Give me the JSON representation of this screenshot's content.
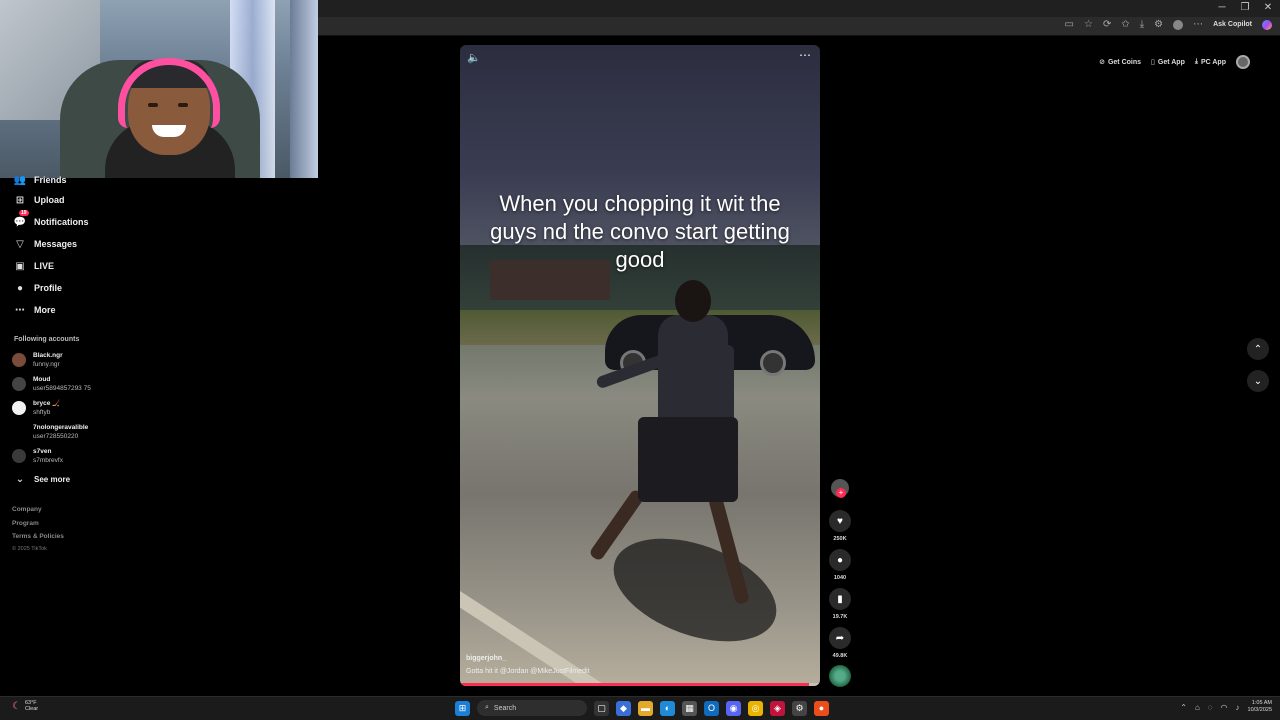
{
  "window": {
    "minimize": "─",
    "restore": "❐",
    "close": "✕"
  },
  "browser": {
    "copilot_label": "Ask Copilot",
    "icons": [
      "screen-icon",
      "star-icon",
      "extension-icon",
      "favorites-icon",
      "download-icon",
      "profile-icon",
      "menu-icon"
    ]
  },
  "sidebar": {
    "items": [
      {
        "label": "Friends",
        "icon": "friends-icon"
      },
      {
        "label": "Upload",
        "icon": "upload-icon"
      },
      {
        "label": "Notifications",
        "icon": "notifications-icon",
        "badge": "19"
      },
      {
        "label": "Messages",
        "icon": "messages-icon"
      },
      {
        "label": "LIVE",
        "icon": "live-icon"
      },
      {
        "label": "Profile",
        "icon": "profile-icon"
      },
      {
        "label": "More",
        "icon": "more-icon"
      }
    ],
    "following_title": "Following accounts",
    "accounts": [
      {
        "name": "Black.ngr",
        "handle": "funny.ngr"
      },
      {
        "name": "Moud",
        "handle": "user5894857293 75"
      },
      {
        "name": "bryce 🏒",
        "handle": "shftyb"
      },
      {
        "name": "7nolongeravalible",
        "handle": "user728550220"
      },
      {
        "name": "s7ven",
        "handle": "s7mbrevfx"
      }
    ],
    "see_more": "See more",
    "footer_links": [
      "Company",
      "Program",
      "Terms & Policies"
    ],
    "copyright": "© 2025 TikTok"
  },
  "video": {
    "caption": "When you chopping it wit the guys nd the convo start getting good",
    "author": "biggerjohn_",
    "description": "Gotta hit it @Jordan  @MikeJustFilmedit",
    "progress": 0.97
  },
  "actions": {
    "likes": "250K",
    "comments": "1040",
    "saves": "19.7K",
    "shares": "49.8K"
  },
  "top_right": {
    "get_coins": "Get Coins",
    "get_app": "Get App",
    "pc_app": "PC App"
  },
  "taskbar": {
    "weather_temp": "63°F",
    "weather_desc": "Clear",
    "search_placeholder": "Search",
    "time": "1:05 AM",
    "date": "10/3/2025"
  },
  "colors": {
    "accent": "#fe2c55",
    "background": "#000000"
  }
}
